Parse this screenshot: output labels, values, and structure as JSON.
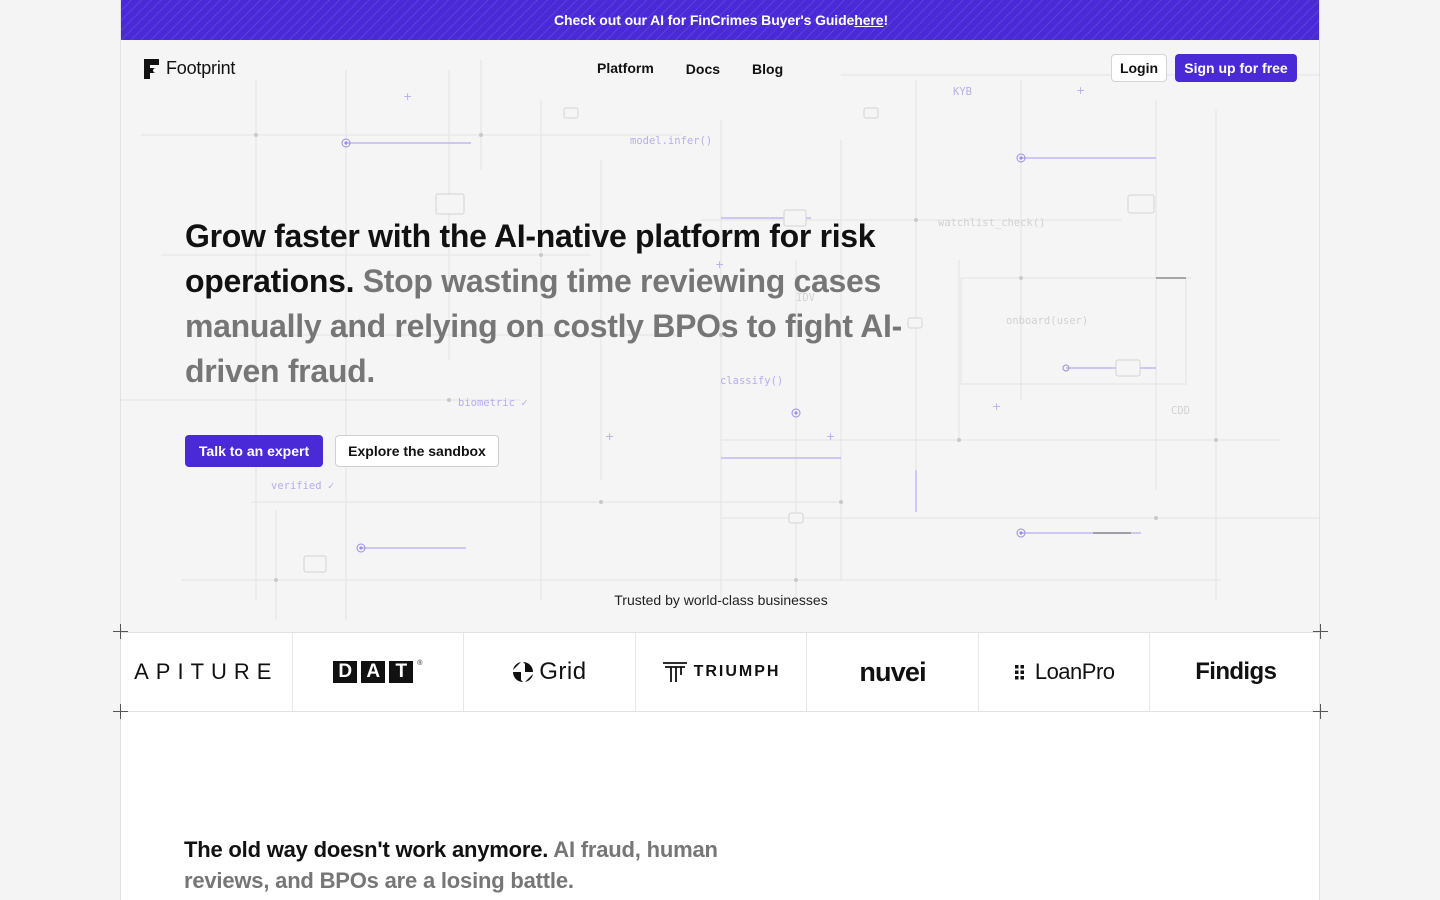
{
  "banner": {
    "text": "Check out our AI for FinCrimes Buyer's Guide ",
    "link": "here",
    "suffix": "!"
  },
  "nav": {
    "brand": "Footprint",
    "links": [
      "Platform",
      "Docs",
      "Blog"
    ],
    "login": "Login",
    "signup": "Sign up for free"
  },
  "hero": {
    "headline_strong": "Grow faster with the AI-native platform for risk operations.",
    "headline_muted": "Stop wasting time reviewing cases manually and relying on costly BPOs to fight AI-driven fraud.",
    "cta_primary": "Talk to an expert",
    "cta_secondary": "Explore the sandbox",
    "background_labels": [
      "model.infer()",
      "KYB",
      "watchlist_check()",
      "IDV",
      "onboard(user)",
      "classify()",
      "biometric ✓",
      "verified ✓",
      "CDD"
    ]
  },
  "trusted": {
    "label": "Trusted by world-class businesses",
    "logos": [
      "APITURE",
      "DAT",
      "Grid",
      "TRIUMPH",
      "nuvei",
      "LoanPro",
      "Findigs"
    ],
    "dat_letters": [
      "D",
      "A",
      "T"
    ],
    "dat_registered": "®"
  },
  "section2": {
    "strong": "The old way doesn't work anymore.",
    "muted": "AI fraud, human reviews, and BPOs are a losing battle."
  },
  "colors": {
    "accent": "#4a2ad6",
    "muted_text": "#767676"
  }
}
